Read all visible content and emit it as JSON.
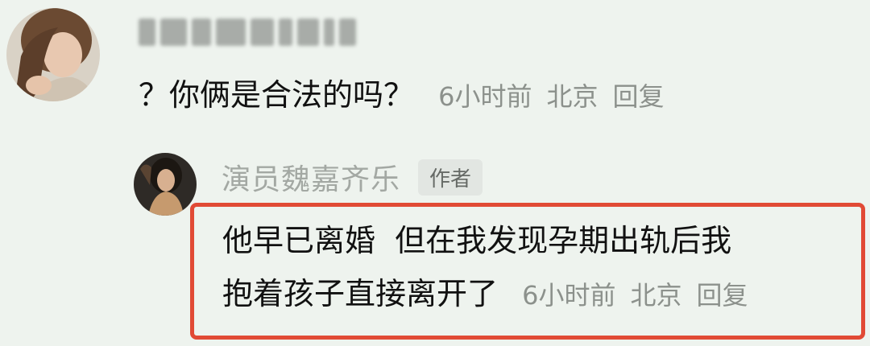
{
  "comment": {
    "author_obscured": true,
    "text": "？你俩是合法的吗？",
    "time": "6小时前",
    "location": "北京",
    "reply_label": "回复"
  },
  "reply": {
    "author": "演员魏嘉齐乐",
    "badge": "作者",
    "text_line1": "他早已离婚  但在我发现孕期出轨后我",
    "text_line2": "抱着孩子直接离开了",
    "time": "6小时前",
    "location": "北京",
    "reply_label": "回复"
  },
  "colors": {
    "background": "#eef3ee",
    "highlight_border": "#e14a35",
    "meta_text": "#8c918c"
  }
}
